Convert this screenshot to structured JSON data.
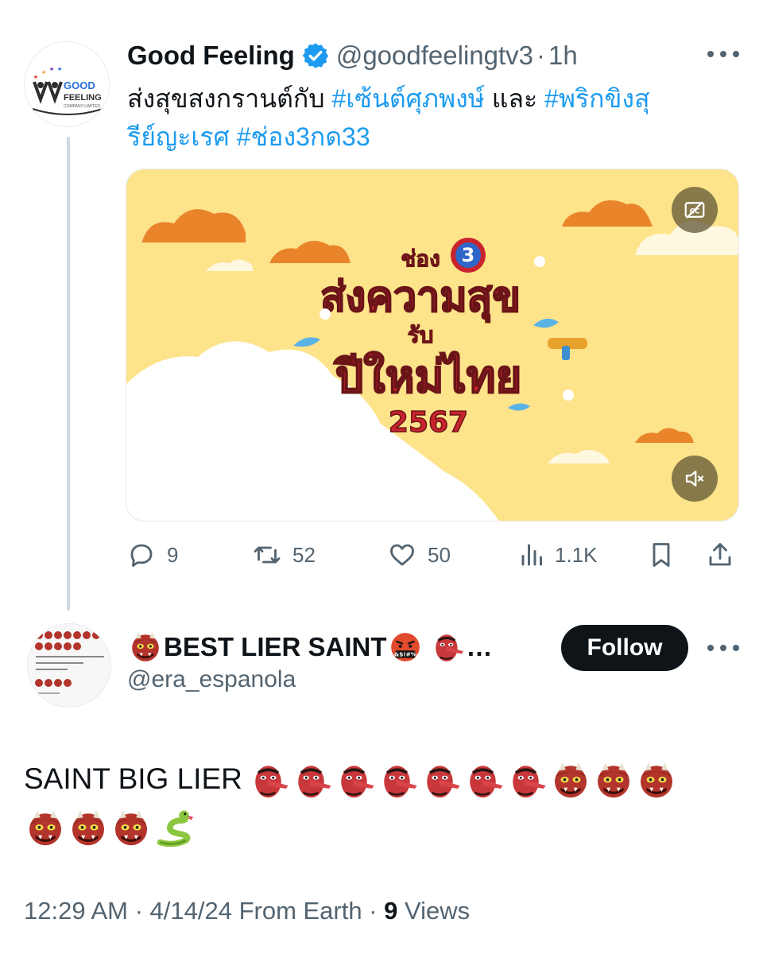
{
  "tweet": {
    "author_name": "Good Feeling",
    "author_handle": "@goodfeelingtv3",
    "separator": "·",
    "time_ago": "1h",
    "text_plain_1": "ส่งสุขสงกรานต์กับ ",
    "hashtag_1": "#เซ้นต์ศุภพงษ์",
    "text_plain_2": " และ ",
    "hashtag_2": "#พริกขิงสุรีย์ญะเรศ",
    "text_plain_3": " ",
    "hashtag_3": "#ช่อง3กด33",
    "avatar_text": {
      "line1": "GOOD",
      "line2": "FEELING",
      "line3": "COMPANY LIMITED"
    },
    "video": {
      "title_line1": "ช่อง",
      "title_num": "3",
      "title_line2": "ส่งความสุข",
      "title_line3": "รับ",
      "title_line4": "ปีใหม่ไทย",
      "title_line5": "2567"
    },
    "stats": {
      "replies": "9",
      "reposts": "52",
      "likes": "50",
      "views": "1.1K"
    }
  },
  "reply": {
    "author_name": "BEST LIER SAINT",
    "name_ellipsis": "…",
    "author_handle": "@era_espanola",
    "follow_label": "Follow",
    "text": "SAINT BIG LIER",
    "emoji_sequence": [
      "tengu",
      "tengu",
      "tengu",
      "tengu",
      "tengu",
      "tengu",
      "tengu",
      "ogre",
      "ogre",
      "ogre",
      "ogre",
      "ogre",
      "ogre",
      "snake"
    ],
    "timestamp": "12:29 AM · 4/14/24 From Earth · ",
    "views_count": "9",
    "views_label": " Views"
  },
  "icons": [
    "verified-badge-icon",
    "more-icon",
    "cc-icon",
    "mute-icon",
    "reply-icon",
    "repost-icon",
    "like-icon",
    "views-icon",
    "bookmark-icon",
    "share-icon",
    "ogre-emoji-icon",
    "tengu-emoji-icon",
    "angry-emoji-icon",
    "snake-emoji-icon"
  ],
  "colors": {
    "link": "#1d9bf0",
    "text": "#0f1419",
    "secondary": "#536471",
    "verified": "#1d9bf0",
    "follow_bg": "#0f1419",
    "video_bg": "#fde38a"
  }
}
